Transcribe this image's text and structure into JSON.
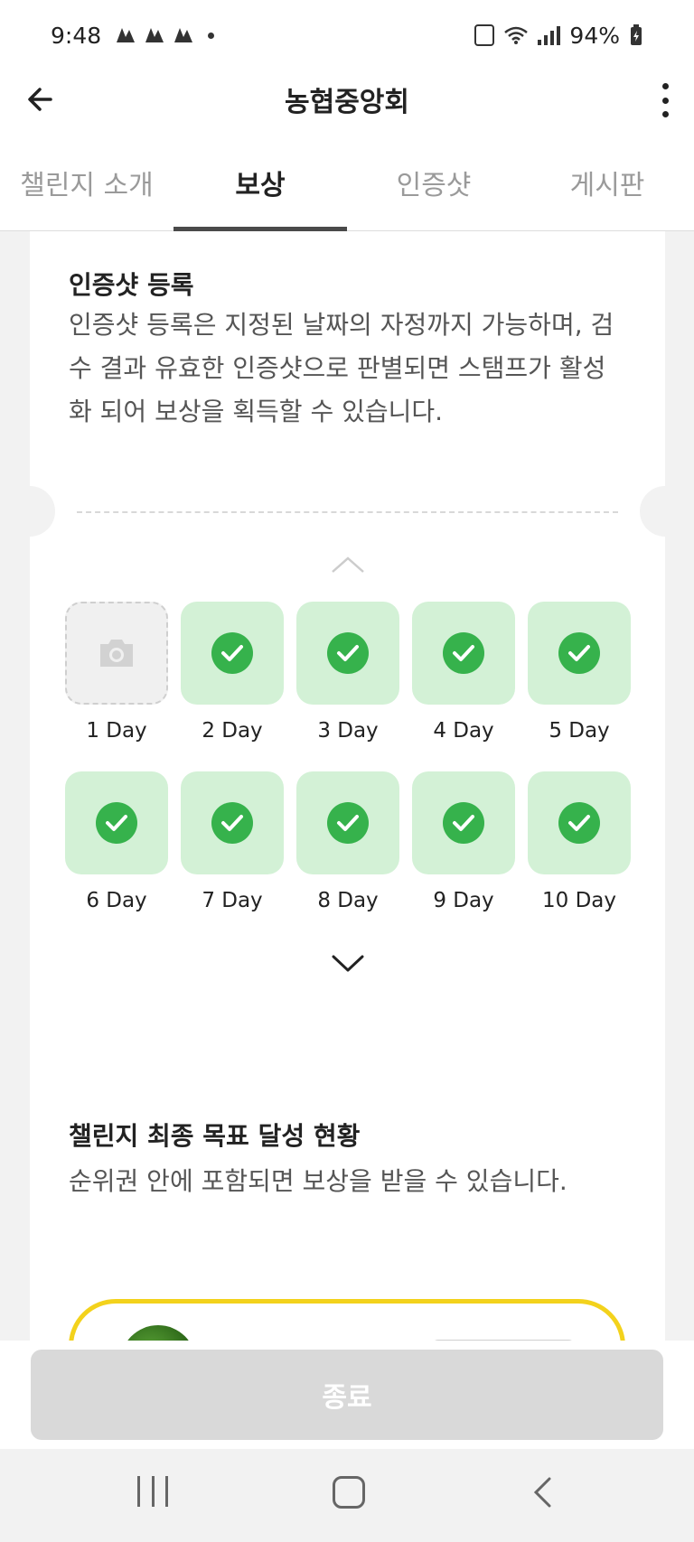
{
  "status_bar": {
    "time": "9:48",
    "battery": "94%",
    "icons": [
      "notification-icon",
      "wifi-icon",
      "signal-icon",
      "battery-icon"
    ]
  },
  "header": {
    "title": "농협중앙회",
    "icons": [
      "back-arrow-icon",
      "more-vertical-icon"
    ]
  },
  "tabs": [
    {
      "label": "챌린지 소개",
      "active": false
    },
    {
      "label": "보상",
      "active": true
    },
    {
      "label": "인증샷",
      "active": false
    },
    {
      "label": "게시판",
      "active": false
    }
  ],
  "stamp_card": {
    "title": "인증샷 등록",
    "description": "인증샷 등록은 지정된 날짜의 자정까지 가능하며, 검수 결과 유효한 인증샷으로 판별되면 스탬프가 활성화 되어 보상을 획득할 수 있습니다.",
    "days": [
      {
        "label": "1 Day",
        "completed": false,
        "icon": "camera-icon"
      },
      {
        "label": "2 Day",
        "completed": true,
        "icon": "check-circle-icon"
      },
      {
        "label": "3 Day",
        "completed": true,
        "icon": "check-circle-icon"
      },
      {
        "label": "4 Day",
        "completed": true,
        "icon": "check-circle-icon"
      },
      {
        "label": "5 Day",
        "completed": true,
        "icon": "check-circle-icon"
      },
      {
        "label": "6 Day",
        "completed": true,
        "icon": "check-circle-icon"
      },
      {
        "label": "7 Day",
        "completed": true,
        "icon": "check-circle-icon"
      },
      {
        "label": "8 Day",
        "completed": true,
        "icon": "check-circle-icon"
      },
      {
        "label": "9 Day",
        "completed": true,
        "icon": "check-circle-icon"
      },
      {
        "label": "10 Day",
        "completed": true,
        "icon": "check-circle-icon"
      }
    ]
  },
  "goal_card": {
    "title": "챌린지 최종 목표 달성 현황",
    "description": "순위권 안에 포함되면 보상을 받을 수 있습니다."
  },
  "footer": {
    "end_button": "종료"
  },
  "colors": {
    "stamp_bg": "#d3f1d6",
    "check": "#36b24c",
    "rank_border": "#f3d21c",
    "disabled_button": "#d9d9d9"
  }
}
